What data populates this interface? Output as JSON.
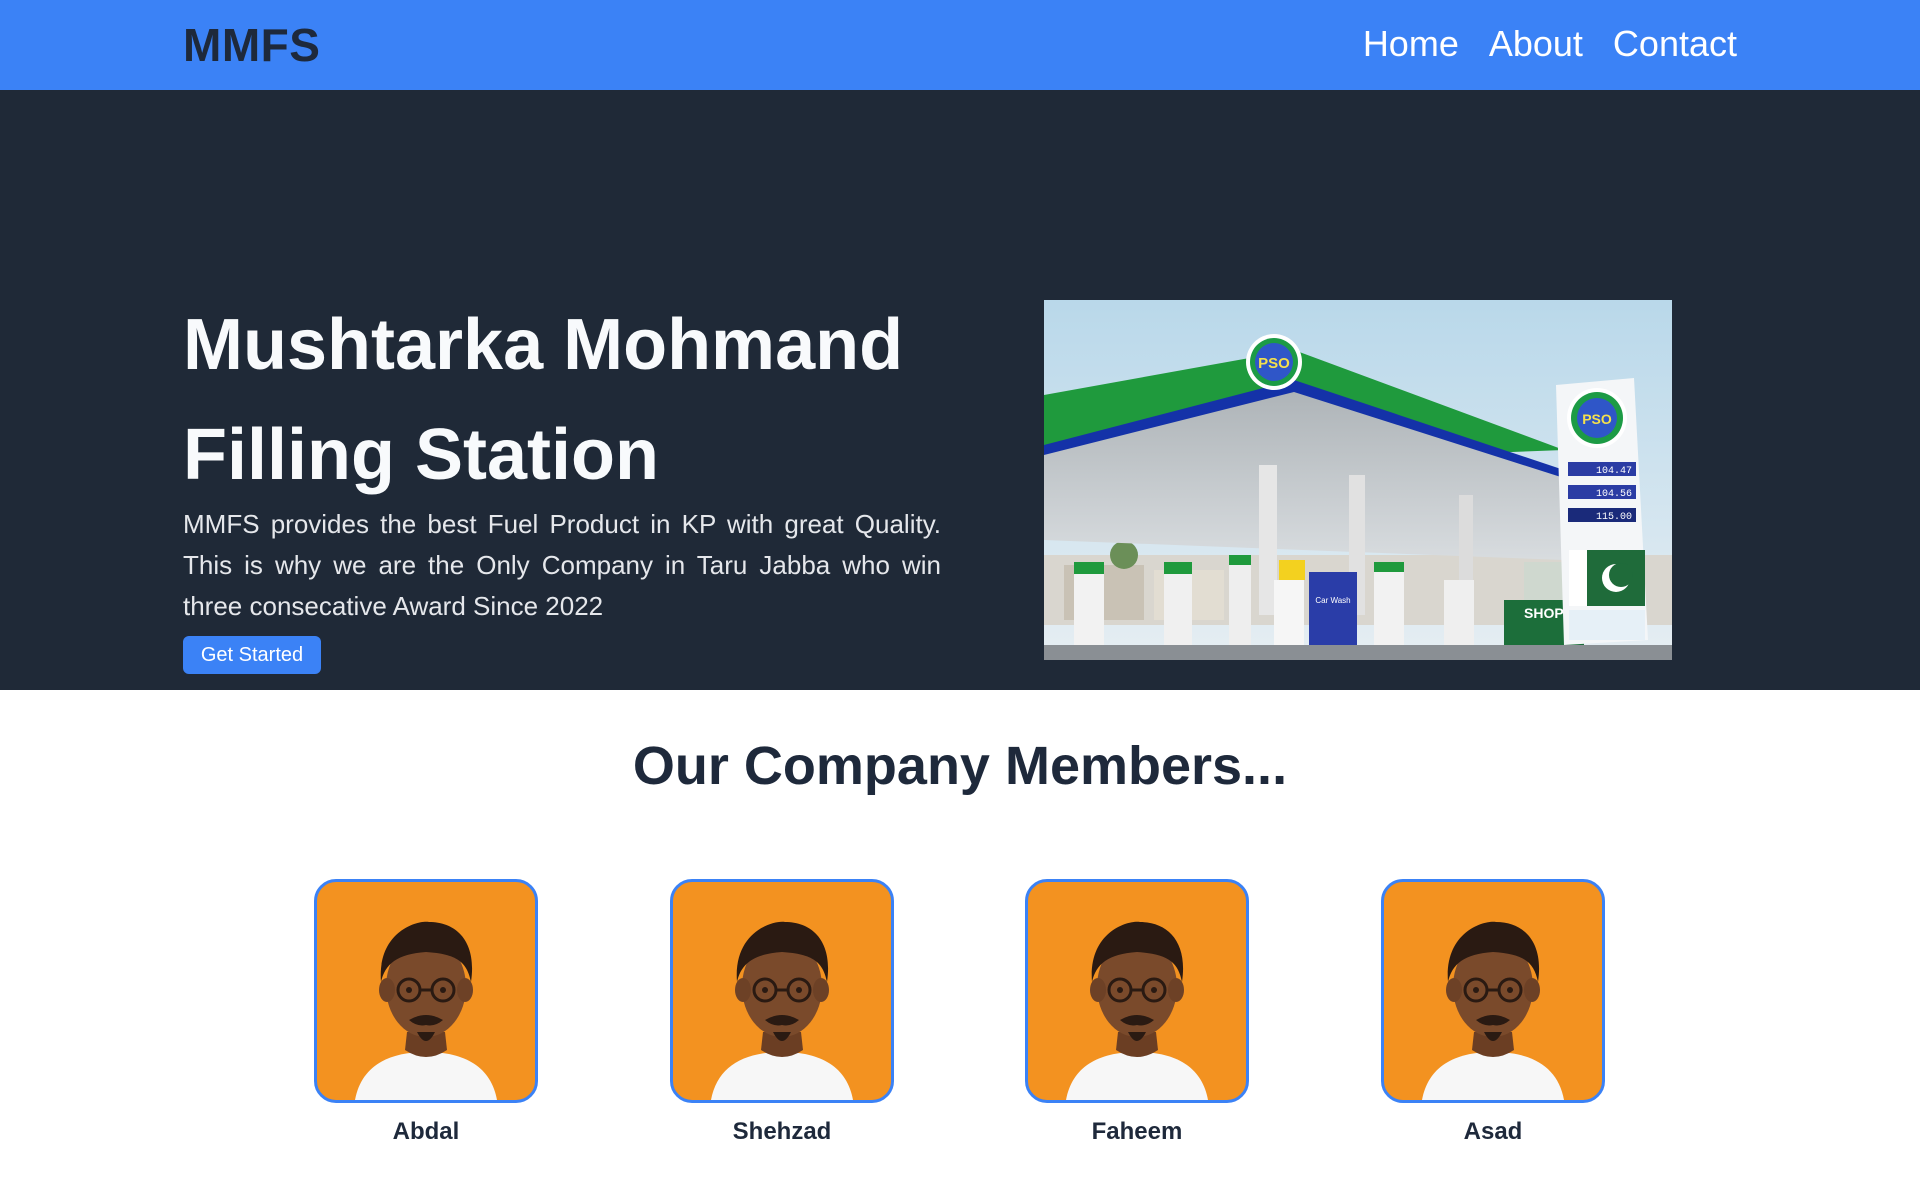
{
  "nav": {
    "brand": "MMFS",
    "links": [
      {
        "label": "Home"
      },
      {
        "label": "About"
      },
      {
        "label": "Contact"
      }
    ]
  },
  "hero": {
    "title_line1": "Mushtarka Mohmand",
    "title_line2": "Filling Station",
    "description": "MMFS provides the best Fuel Product in KP with great Quality. This is why we are the Only Company in Taru Jabba who win three consecative Award Since 2022",
    "cta_label": "Get Started",
    "image": {
      "subject": "PSO fuel station photo",
      "logo_text": "PSO",
      "sign_prices": [
        "104.47",
        "104.56",
        "115.00"
      ],
      "shop_text": "SHOP",
      "car_wash_text": "Car Wash"
    }
  },
  "members": {
    "title": "Our Company Members...",
    "items": [
      {
        "name": "Abdal"
      },
      {
        "name": "Shehzad"
      },
      {
        "name": "Faheem"
      },
      {
        "name": "Asad"
      }
    ]
  },
  "colors": {
    "navbar": "#3b82f6",
    "hero_bg": "#1f2937",
    "brand_text": "#1e293b",
    "avatar_bg": "#f39220",
    "avatar_border": "#3b82f6"
  }
}
